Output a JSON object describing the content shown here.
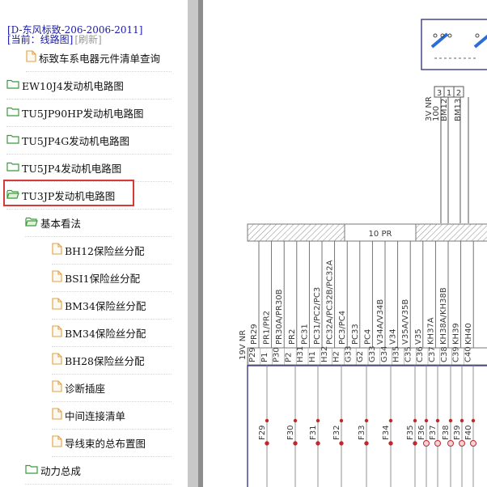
{
  "sidebar": {
    "doc_title": "[D-东风标致-206-2006-2011]",
    "breadcrumb_current": "[当前：线路图]",
    "refresh": "[刷新]",
    "items": [
      {
        "label": "标致车系电器元件清单查询",
        "icon": "file-icon"
      },
      {
        "label": "EW10J4发动机电路图",
        "icon": "folder-icon"
      },
      {
        "label": "TU5JP90HP发动机电路图",
        "icon": "folder-icon"
      },
      {
        "label": "TU5JP4G发动机电路图",
        "icon": "folder-icon"
      },
      {
        "label": "TU5JP4发动机电路图",
        "icon": "folder-icon"
      },
      {
        "label": "TU3JP发动机电路图",
        "icon": "folder-open-icon"
      },
      {
        "label": "基本看法",
        "icon": "folder-open-icon"
      },
      {
        "label": "BH12保险丝分配",
        "icon": "file-icon"
      },
      {
        "label": "BSI1保险丝分配",
        "icon": "file-icon"
      },
      {
        "label": "BM34保险丝分配",
        "icon": "file-icon"
      },
      {
        "label": "BM34保险丝分配",
        "icon": "file-icon"
      },
      {
        "label": "BH28保险丝分配",
        "icon": "file-icon"
      },
      {
        "label": "诊断插座",
        "icon": "file-icon"
      },
      {
        "label": "中间连接清单",
        "icon": "file-icon"
      },
      {
        "label": "导线束的总布置图",
        "icon": "file-icon"
      },
      {
        "label": "动力总成",
        "icon": "folder-icon"
      }
    ]
  },
  "diagram": {
    "connector_pins": [
      "3",
      "1",
      "2"
    ],
    "top_wire_labels": [
      "3V NR",
      "100",
      "BM12",
      "BM13"
    ],
    "bus_label": "10 PR",
    "side_label": "19V NR",
    "wire_labels": [
      "PR29",
      "PR1/PR2",
      "PR30A/PR30B",
      "PR2",
      "PC31",
      "PC31/PC2/PC3",
      "PC32A/PC32B/PC32A",
      "PC3/PC4",
      "PC33",
      "PC4",
      "V34A/V34B",
      "V34",
      "V35A/V35B",
      "V35",
      "KH37A",
      "KH38A/KH38B",
      "KH39",
      "KH40"
    ],
    "pin_labels": [
      "P29",
      "P1",
      "P30",
      "P2",
      "H31",
      "H1",
      "H32",
      "H2",
      "G33",
      "G2",
      "G33",
      "G34",
      "H35",
      "C35",
      "C36",
      "C37",
      "C38",
      "C39",
      "C40"
    ],
    "fuse_labels": [
      "F29",
      "F30",
      "F31",
      "F32",
      "F33",
      "F34",
      "F35",
      "F36",
      "F37",
      "F38",
      "F39",
      "F40"
    ],
    "colors": {
      "highlight": "#d83a3a",
      "diagram_stroke": "#3a3a8a",
      "link_blue": "#1a1aa6"
    }
  }
}
